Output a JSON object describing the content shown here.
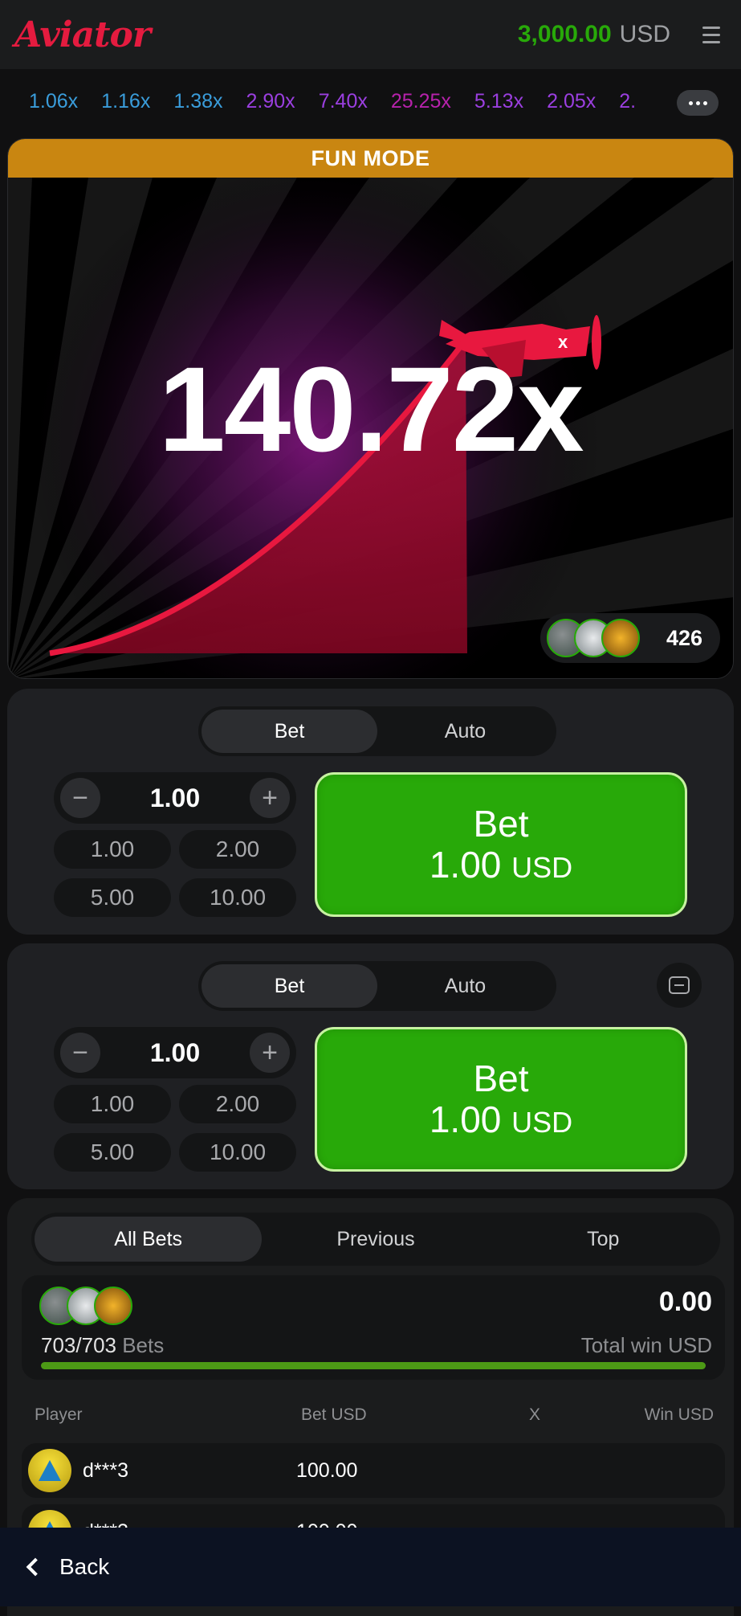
{
  "app": {
    "logo": "Aviator"
  },
  "header": {
    "balance": "3,000.00",
    "currency": "USD",
    "menu_icon": "hamburger-menu-icon"
  },
  "history": {
    "items": [
      {
        "value": "1.06x",
        "color": "#3a9ddb"
      },
      {
        "value": "1.16x",
        "color": "#3a9ddb"
      },
      {
        "value": "1.38x",
        "color": "#3a9ddb"
      },
      {
        "value": "2.90x",
        "color": "#9b3fe0"
      },
      {
        "value": "7.40x",
        "color": "#9b3fe0"
      },
      {
        "value": "25.25x",
        "color": "#b722ac"
      },
      {
        "value": "5.13x",
        "color": "#9b3fe0"
      },
      {
        "value": "2.05x",
        "color": "#9b3fe0"
      },
      {
        "value": "2.",
        "color": "#9b3fe0"
      }
    ],
    "more_icon": "more-dots-icon"
  },
  "game": {
    "mode_banner": "FUN MODE",
    "multiplier": "140.72x",
    "players_count": "426",
    "plane_icon": "airplane-icon"
  },
  "bet_panels": [
    {
      "tabs": [
        "Bet",
        "Auto"
      ],
      "active_tab": "Bet",
      "amount": "1.00",
      "quick": [
        "1.00",
        "2.00",
        "5.00",
        "10.00"
      ],
      "button_label": "Bet",
      "button_amount": "1.00",
      "button_currency": "USD"
    },
    {
      "tabs": [
        "Bet",
        "Auto"
      ],
      "active_tab": "Bet",
      "amount": "1.00",
      "quick": [
        "1.00",
        "2.00",
        "5.00",
        "10.00"
      ],
      "button_label": "Bet",
      "button_amount": "1.00",
      "button_currency": "USD"
    }
  ],
  "bets": {
    "tabs": [
      "All Bets",
      "Previous",
      "Top"
    ],
    "active_tab": "All Bets",
    "count": "703/703",
    "count_label": "Bets",
    "total_win": "0.00",
    "total_win_label": "Total win USD",
    "progress": 1.0,
    "columns": [
      "Player",
      "Bet USD",
      "X",
      "Win USD"
    ],
    "rows": [
      {
        "player": "d***3",
        "bet": "100.00"
      },
      {
        "player": "d***3",
        "bet": "100.00"
      }
    ]
  },
  "footer": {
    "back_label": "Back"
  }
}
